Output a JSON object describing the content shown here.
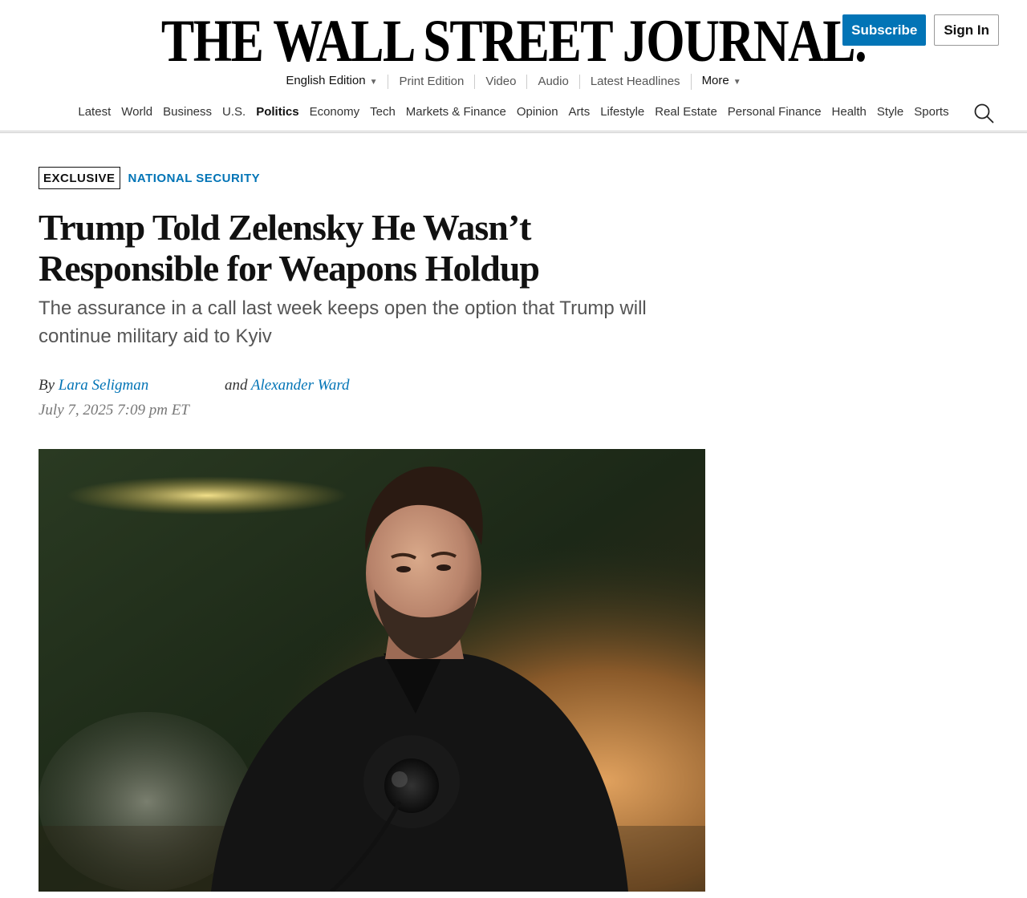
{
  "header": {
    "masthead": "THE WALL STREET JOURNAL.",
    "subscribe_label": "Subscribe",
    "signin_label": "Sign In"
  },
  "subnav": {
    "edition": "English Edition",
    "print_edition": "Print Edition",
    "video": "Video",
    "audio": "Audio",
    "latest_headlines": "Latest Headlines",
    "more": "More"
  },
  "mainnav": {
    "items": [
      "Latest",
      "World",
      "Business",
      "U.S.",
      "Politics",
      "Economy",
      "Tech",
      "Markets & Finance",
      "Opinion",
      "Arts",
      "Lifestyle",
      "Real Estate",
      "Personal Finance",
      "Health",
      "Style",
      "Sports"
    ],
    "active": "Politics"
  },
  "article": {
    "flag": "EXCLUSIVE",
    "section": "NATIONAL SECURITY",
    "headline": "Trump Told Zelensky He Wasn’t Responsible for Weapons Holdup",
    "dek": "The assurance in a call last week keeps open the option that Trump will continue military aid to Kyiv",
    "byline": {
      "by": "By",
      "author1": "Lara Seligman",
      "and": "and",
      "author2": "Alexander Ward"
    },
    "timestamp": "July 7, 2025 7:09 pm ET"
  },
  "colors": {
    "accent": "#0274b6",
    "text": "#111111",
    "muted": "#555555"
  }
}
